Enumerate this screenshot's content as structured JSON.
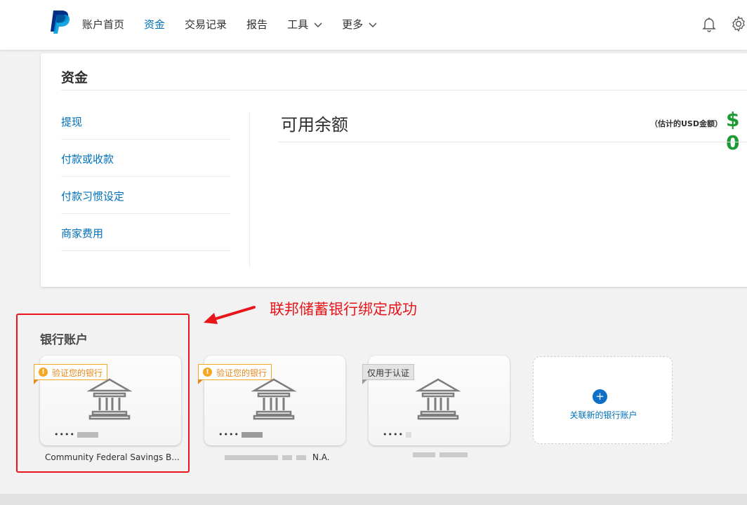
{
  "nav": {
    "items": [
      {
        "label": "账户首页",
        "active": false,
        "dropdown": false
      },
      {
        "label": "资金",
        "active": true,
        "dropdown": false
      },
      {
        "label": "交易记录",
        "active": false,
        "dropdown": false
      },
      {
        "label": "报告",
        "active": false,
        "dropdown": false
      },
      {
        "label": "工具",
        "active": false,
        "dropdown": true
      },
      {
        "label": "更多",
        "active": false,
        "dropdown": true
      }
    ],
    "icons": [
      "paypal-logo",
      "bell-icon",
      "gear-icon"
    ]
  },
  "funds": {
    "title": "资金",
    "menu": [
      "提现",
      "付款或收款",
      "付款习惯设定",
      "商家费用"
    ],
    "balance_label": "可用余额",
    "usd_note": "（估计的USD金额）",
    "amount_prefix": "$ 0"
  },
  "annotation": {
    "text": "联邦储蓄银行绑定成功",
    "color": "#e8151a"
  },
  "banks": {
    "title": "银行账户",
    "cards": [
      {
        "badge": "验证您的银行",
        "badge_type": "warning",
        "masked_number": "••••",
        "name": "Community Federal Savings B..."
      },
      {
        "badge": "验证您的银行",
        "badge_type": "warning",
        "masked_number": "••••",
        "name": "N.A."
      },
      {
        "badge": "仅用于认证",
        "badge_type": "info",
        "masked_number": "••••",
        "name": ""
      }
    ],
    "add_label": "关联新的银行账户",
    "add_icon": "+"
  },
  "colors": {
    "link": "#0070ba",
    "balance_green": "#1c9a34",
    "warning": "#f5a623"
  }
}
